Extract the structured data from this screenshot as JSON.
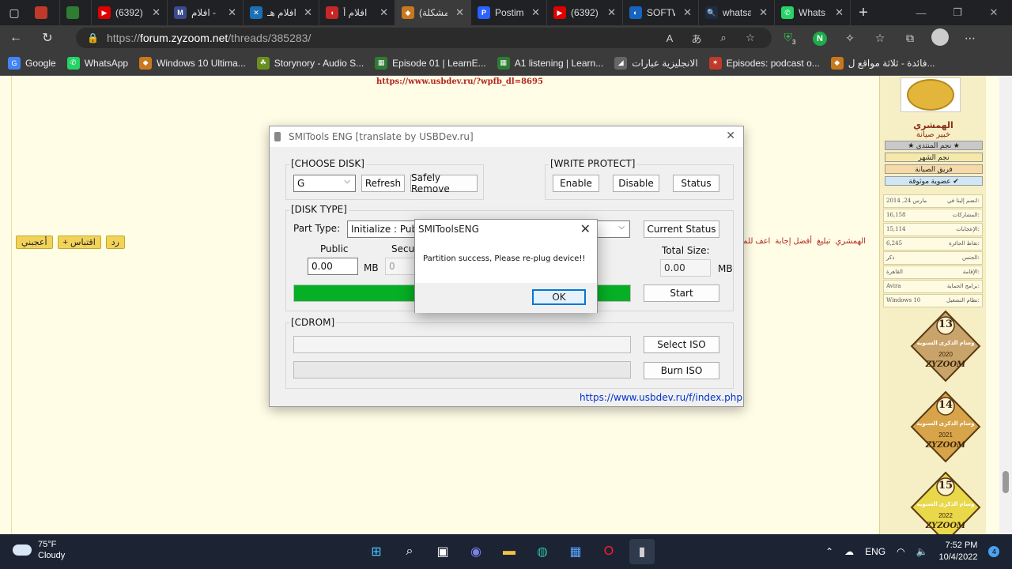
{
  "browser": {
    "tabs": [
      {
        "title": "",
        "fav": "#c0392b",
        "favtext": "",
        "icon": "generic-favicon-icon"
      },
      {
        "title": "",
        "fav": "#2e7d32",
        "favtext": "",
        "icon": "generic-favicon-icon"
      },
      {
        "title": "(6392)",
        "fav": "#e00000",
        "favtext": "▶",
        "icon": "youtube-icon"
      },
      {
        "title": "افلام -",
        "fav": "#3b4b8f",
        "favtext": "M",
        "icon": "generic-favicon-icon"
      },
      {
        "title": "افلام هـ",
        "fav": "#1a6fb5",
        "favtext": "✕",
        "icon": "generic-favicon-icon"
      },
      {
        "title": "افلام أ",
        "fav": "#c62828",
        "favtext": "◖",
        "icon": "generic-favicon-icon"
      },
      {
        "title": "(مشكلة",
        "fav": "#c8781e",
        "favtext": "◆",
        "icon": "zyzoom-icon"
      },
      {
        "title": "Postim",
        "fav": "#2962ff",
        "favtext": "P",
        "icon": "postimage-icon"
      },
      {
        "title": "(6392)",
        "fav": "#e00000",
        "favtext": "▶",
        "icon": "youtube-icon"
      },
      {
        "title": "SOFTW",
        "fav": "#1565c0",
        "favtext": "◐",
        "icon": "generic-favicon-icon"
      },
      {
        "title": "whatsa",
        "fav": "#1f2a44",
        "favtext": "🔍",
        "icon": "search-icon"
      },
      {
        "title": "Whats",
        "fav": "#25d366",
        "favtext": "✆",
        "icon": "whatsapp-icon"
      }
    ],
    "active_tab_index": 6,
    "url_prefix": "https://",
    "url_host": "forum.zyzoom.net",
    "url_path": "/threads/385283/",
    "extension_badge": "3",
    "bookmarks": [
      {
        "label": "Google",
        "color": "#4285f4",
        "glyph": "G",
        "icon": "google-icon"
      },
      {
        "label": "WhatsApp",
        "color": "#25d366",
        "glyph": "✆",
        "icon": "whatsapp-icon"
      },
      {
        "label": "Windows 10 Ultima...",
        "color": "#c8781e",
        "glyph": "◆",
        "icon": "zyzoom-icon"
      },
      {
        "label": "Storynory - Audio S...",
        "color": "#6b8e23",
        "glyph": "☘",
        "icon": "storynory-icon"
      },
      {
        "label": "Episode 01 | LearnE...",
        "color": "#2e7d32",
        "glyph": "▦",
        "icon": "learnenglish-icon"
      },
      {
        "label": "A1 listening | Learn...",
        "color": "#2e7d32",
        "glyph": "▦",
        "icon": "learnenglish-icon"
      },
      {
        "label": "الانجليزية عبارات",
        "color": "#666",
        "glyph": "◢",
        "icon": "bookmark-icon"
      },
      {
        "label": "Episodes: podcast o...",
        "color": "#c0392b",
        "glyph": "✶",
        "icon": "podcast-icon"
      },
      {
        "label": "فائدة - ثلاثة مواقع ل...",
        "color": "#c8781e",
        "glyph": "◆",
        "icon": "zyzoom-icon"
      }
    ]
  },
  "page": {
    "top_link": "https://www.usbdev.ru/?wpfb_dl=8695",
    "post_buttons": [
      "أعجبني",
      "+ اقتباس",
      "رد"
    ],
    "post_links": [
      "الهمشري",
      "تبليغ",
      "أفضل إجابة",
      "اعف للمقد"
    ]
  },
  "profile": {
    "username": "الهمشري",
    "usertitle": "خبير صيانة",
    "ranks": [
      {
        "label": "★ نجم المنتدى ★",
        "bg": "#c9c9c9"
      },
      {
        "label": "نجم الشهر",
        "bg": "#f4e9a8"
      },
      {
        "label": "فريق الصيانة",
        "bg": "#f7d9a8"
      },
      {
        "label": "عضوية موثوقة ✔",
        "bg": "#cfe6f5"
      }
    ],
    "stats": [
      {
        "key": "انضم إلينا في:",
        "value": "مارس 24, 2014"
      },
      {
        "key": "المشاركات:",
        "value": "16,158"
      },
      {
        "key": "الإعجابات:",
        "value": "15,114"
      },
      {
        "key": "نقاط الجائزة:",
        "value": "6,245"
      },
      {
        "key": "الجنس:",
        "value": "ذكر"
      },
      {
        "key": "الإقامة:",
        "value": "القاهرة"
      },
      {
        "key": "برامج الحماية:",
        "value": "Avira"
      },
      {
        "key": "نظام التشغيل:",
        "value": "Windows 10"
      }
    ],
    "medals": [
      {
        "num": "13",
        "caption": "وسام الذكرى السنوية",
        "year": "2020",
        "color": "#c9a46a"
      },
      {
        "num": "14",
        "caption": "وسام الذكرى السنوية",
        "year": "2021",
        "color": "#d8a44a"
      },
      {
        "num": "15",
        "caption": "وسام الذكرى السنوية",
        "year": "2022",
        "color": "#e8d84a"
      }
    ],
    "medal_brand": "ZYZOOM"
  },
  "smitools": {
    "title": "SMITools ENG [translate by USBDev.ru]",
    "choose_disk_label": "[CHOOSE DISK]",
    "disk_value": "G",
    "refresh_label": "Refresh",
    "safely_remove_label": "Safely Remove",
    "write_protect_label": "[WRITE PROTECT]",
    "enable_label": "Enable",
    "disable_label": "Disable",
    "status_label": "Status",
    "disk_type_label": "[DISK TYPE]",
    "part_type_label": "Part Type:",
    "part_type_value": "Initialize : Public",
    "current_status_label": "Current Status",
    "public_label": "Public",
    "public_value": "0.00",
    "mb_label": "MB",
    "secure_label": "Secur",
    "secure_value": "0",
    "total_size_label": "Total Size:",
    "total_size_value": "0.00",
    "progress": 1.0,
    "start_label": "Start",
    "cdrom_label": "[CDROM]",
    "select_iso_label": "Select ISO",
    "burn_iso_label": "Burn ISO",
    "link": "https://www.usbdev.ru/f/index.php"
  },
  "msgbox": {
    "title": "SMIToolsENG",
    "message": "Partition success, Please re-plug device!!",
    "ok_label": "OK"
  },
  "taskbar": {
    "temp": "75°F",
    "condition": "Cloudy",
    "apps": [
      {
        "icon": "start-icon",
        "glyph": "⊞",
        "color": "#4cc2ff"
      },
      {
        "icon": "search-icon",
        "glyph": "⌕",
        "color": "#ffffff"
      },
      {
        "icon": "task-view-icon",
        "glyph": "▣",
        "color": "#ffffff"
      },
      {
        "icon": "teams-chat-icon",
        "glyph": "◉",
        "color": "#7b83eb"
      },
      {
        "icon": "file-explorer-icon",
        "glyph": "▬",
        "color": "#f3c243"
      },
      {
        "icon": "edge-icon",
        "glyph": "◍",
        "color": "#2fb8a0"
      },
      {
        "icon": "store-icon",
        "glyph": "▦",
        "color": "#58a6ff"
      },
      {
        "icon": "opera-icon",
        "glyph": "O",
        "color": "#ff1b2d"
      },
      {
        "icon": "usb-tool-icon",
        "glyph": "▮",
        "color": "#cfcfcf"
      }
    ],
    "language": "ENG",
    "time": "7:52 PM",
    "date": "10/4/2022",
    "notifications": "4"
  }
}
